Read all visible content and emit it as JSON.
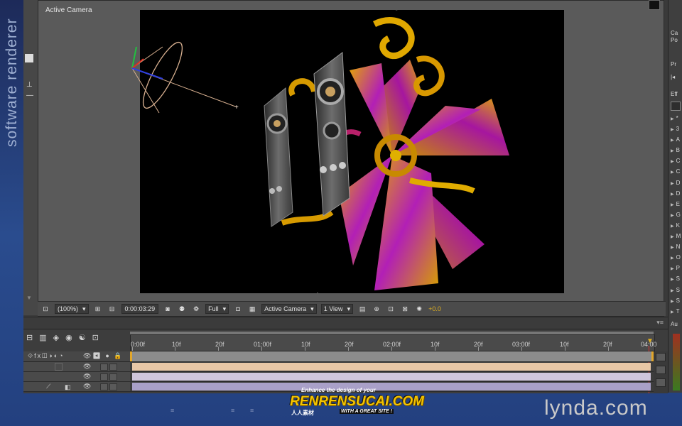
{
  "side_label": "software renderer",
  "viewer": {
    "title": "Active Camera",
    "toolbar": {
      "magnification": "(100%)",
      "timecode": "0:00:03:29",
      "resolution": "Full",
      "view": "Active Camera",
      "layout": "1 View",
      "exposure": "+0.0"
    }
  },
  "right_panel": {
    "info_labels": [
      "Ca",
      "Po"
    ],
    "preview_label": "Pr",
    "effects_label": "Eff",
    "effects_items": [
      "*",
      "3",
      "A",
      "B",
      "C",
      "C",
      "D",
      "D",
      "E",
      "G",
      "K",
      "M",
      "N",
      "O",
      "P",
      "S",
      "S",
      "S",
      "T"
    ],
    "audio_label": "Au"
  },
  "timeline": {
    "ruler_labels": [
      "0:00f",
      "10f",
      "20f",
      "01:00f",
      "10f",
      "20f",
      "02:00f",
      "10f",
      "20f",
      "03:00f",
      "10f",
      "20f",
      "04:00"
    ],
    "layers": [
      {
        "color": "#e8c7a6"
      },
      {
        "color": "#cfc5db"
      },
      {
        "color": "#a9a0c8"
      }
    ]
  },
  "watermark": {
    "top": "Enhance the design of your",
    "main": "RENRENSUCAI.COM",
    "bottom_cn": "人人素材",
    "bottom_en": "WITH A GREAT SITE !"
  },
  "brand": "lynda.com",
  "colors": {
    "accent": "#e0b020",
    "cti": "#e03030"
  }
}
